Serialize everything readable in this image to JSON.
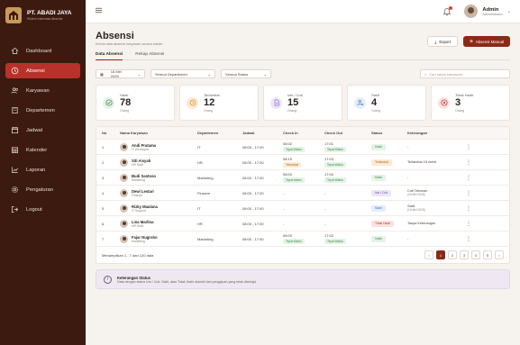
{
  "brand": {
    "name": "PT. ABADI JAYA",
    "subtitle": "Sistem Informasi Absensi"
  },
  "sidebar": {
    "items": [
      {
        "label": "Dashboard",
        "icon": "home-icon",
        "active": false
      },
      {
        "label": "Absensi",
        "icon": "clock-icon",
        "active": true
      },
      {
        "label": "Karyawan",
        "icon": "users-icon",
        "active": false
      },
      {
        "label": "Departemen",
        "icon": "building-icon",
        "active": false
      },
      {
        "label": "Jadwal",
        "icon": "calendar-icon",
        "active": false
      },
      {
        "label": "Kalender",
        "icon": "calendar-grid-icon",
        "active": false
      },
      {
        "label": "Laporan",
        "icon": "chart-icon",
        "active": false
      },
      {
        "label": "Pengaturan",
        "icon": "gear-icon",
        "active": false
      },
      {
        "label": "Logout",
        "icon": "logout-icon",
        "active": false
      }
    ]
  },
  "topbar": {
    "user_name": "Admin",
    "user_role": "Administrator"
  },
  "page": {
    "title": "Absensi",
    "subtitle": "Kelola data absensi karyawan secara harian",
    "export_label": "Export",
    "manual_label": "Absensi Manual"
  },
  "tabs": [
    "Data Absensi",
    "Rekap Absensi"
  ],
  "filters": {
    "date": "16 Mei 2025",
    "department": "Semua Departemen",
    "status": "Semua Status",
    "search_placeholder": "Cari nama karyawan..."
  },
  "stats": [
    {
      "label": "Hadir",
      "value": "78",
      "unit": "Orang",
      "color": "#3c8c4a",
      "bg": "#e4f3e6",
      "icon": "check-circle-icon"
    },
    {
      "label": "Terlambat",
      "value": "12",
      "unit": "Orang",
      "color": "#d48a2a",
      "bg": "#fbe9d2",
      "icon": "clock-icon"
    },
    {
      "label": "Izin / Cuti",
      "value": "15",
      "unit": "Orang",
      "color": "#8a6cc4",
      "bg": "#ece6f7",
      "icon": "document-icon"
    },
    {
      "label": "Sakit",
      "value": "4",
      "unit": "Orang",
      "color": "#3a6fb5",
      "bg": "#e3eefb",
      "icon": "user-medical-icon"
    },
    {
      "label": "Tidak Hadir",
      "value": "3",
      "unit": "Orang",
      "color": "#c2382a",
      "bg": "#fbe1df",
      "icon": "x-circle-icon"
    }
  ],
  "table": {
    "headers": [
      "No",
      "Nama Karyawan",
      "Departemen",
      "Jadwal",
      "Check In",
      "Check Out",
      "Status",
      "Keterangan"
    ],
    "rows": [
      {
        "no": "1",
        "name": "Andi Pratama",
        "role": "IT Developer",
        "dept": "IT",
        "schedule": "08:00 - 17:00",
        "in": "08:02",
        "in_tag": "Tepat Waktu",
        "out": "17:01",
        "out_tag": "Tepat Waktu",
        "status": "Hadir",
        "status_class": "st-hadir",
        "note": "-",
        "note_sub": ""
      },
      {
        "no": "2",
        "name": "Siti Aisyah",
        "role": "HR Staff",
        "dept": "HR",
        "schedule": "08:00 - 17:00",
        "in": "08:15",
        "in_tag": "Terlambat",
        "out": "17:03",
        "out_tag": "Tepat Waktu",
        "status": "Terlambat",
        "status_class": "st-telat",
        "note": "Terlambat 15 menit",
        "note_sub": ""
      },
      {
        "no": "3",
        "name": "Budi Santoso",
        "role": "Marketing",
        "dept": "Marketing",
        "schedule": "08:00 - 17:00",
        "in": "08:00",
        "in_tag": "Tepat Waktu",
        "out": "17:00",
        "out_tag": "Tepat Waktu",
        "status": "Hadir",
        "status_class": "st-hadir",
        "note": "-",
        "note_sub": ""
      },
      {
        "no": "4",
        "name": "Dewi Lestari",
        "role": "Finance",
        "dept": "Finance",
        "schedule": "08:00 - 17:00",
        "in": "-",
        "in_tag": "",
        "out": "-",
        "out_tag": "",
        "status": "Izin / Cuti",
        "status_class": "st-izin",
        "note": "Cuti Tahunan",
        "note_sub": "(16 Mei 2025)"
      },
      {
        "no": "5",
        "name": "Rizky Maulana",
        "role": "IT Support",
        "dept": "IT",
        "schedule": "08:00 - 17:00",
        "in": "-",
        "in_tag": "",
        "out": "-",
        "out_tag": "",
        "status": "Sakit",
        "status_class": "st-sakit",
        "note": "Sakit",
        "note_sub": "(16 Mei 2025)"
      },
      {
        "no": "6",
        "name": "Lina Marlina",
        "role": "HR Staff",
        "dept": "HR",
        "schedule": "08:00 - 17:00",
        "in": "-",
        "in_tag": "",
        "out": "-",
        "out_tag": "",
        "status": "Tidak Hadir",
        "status_class": "st-tidak",
        "note": "Tanpa Keterangan",
        "note_sub": ""
      },
      {
        "no": "7",
        "name": "Fajar Nugroho",
        "role": "Marketing",
        "dept": "Marketing",
        "schedule": "08:00 - 17:00",
        "in": "08:00",
        "in_tag": "Tepat Waktu",
        "out": "17:02",
        "out_tag": "Tepat Waktu",
        "status": "Hadir",
        "status_class": "st-hadir",
        "note": "-",
        "note_sub": ""
      }
    ]
  },
  "pagination": {
    "summary": "Menampilkan 1 - 7 dari 120 data",
    "prev": "‹",
    "next": "›",
    "pages": [
      "1",
      "2",
      "3",
      "4",
      "5"
    ]
  },
  "info": {
    "title": "Keterangan Status",
    "text": "Data dengan status Izin / Cuti, Sakit, atau Tidak Hadir diambil dari pengajuan yang telah disetujui."
  }
}
